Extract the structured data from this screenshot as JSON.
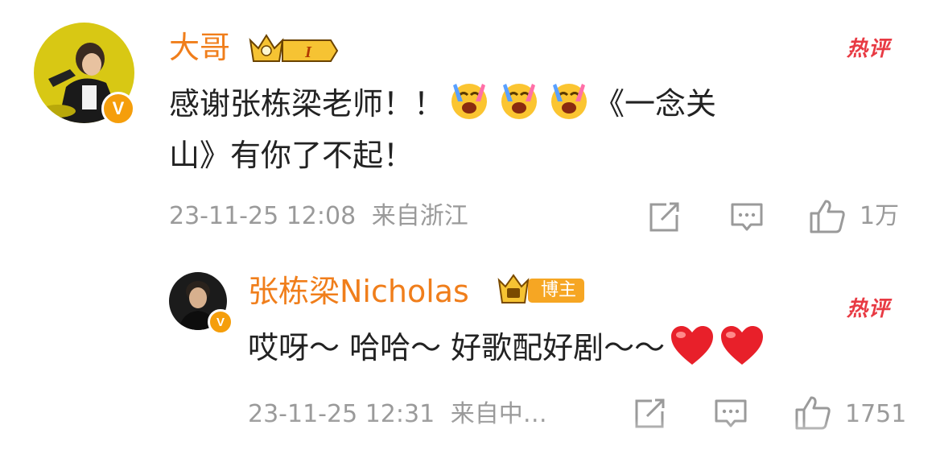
{
  "comment": {
    "username": "大哥",
    "vip_level": "I",
    "hot_label": "热评",
    "text_part1": "感谢张栋梁老师！！",
    "text_part2": "《一念关",
    "text_line2": "山》有你了不起！",
    "timestamp": "23-11-25 12:08",
    "location": "来自浙江",
    "likes": "1万",
    "emoji_icon": "laugh-cry-emoji"
  },
  "reply": {
    "username": "张栋梁Nicholas",
    "author_badge": "博主",
    "hot_label": "热评",
    "text": "哎呀～ 哈哈～ 好歌配好剧～～",
    "timestamp": "23-11-25 12:31",
    "location": "来自中…",
    "likes": "1751",
    "emoji_icon": "red-heart-emoji"
  },
  "colors": {
    "username": "#f07e1b",
    "hot_label": "#e83a43",
    "meta": "#9a9a9a",
    "verified_badge": "#f59e0b"
  }
}
